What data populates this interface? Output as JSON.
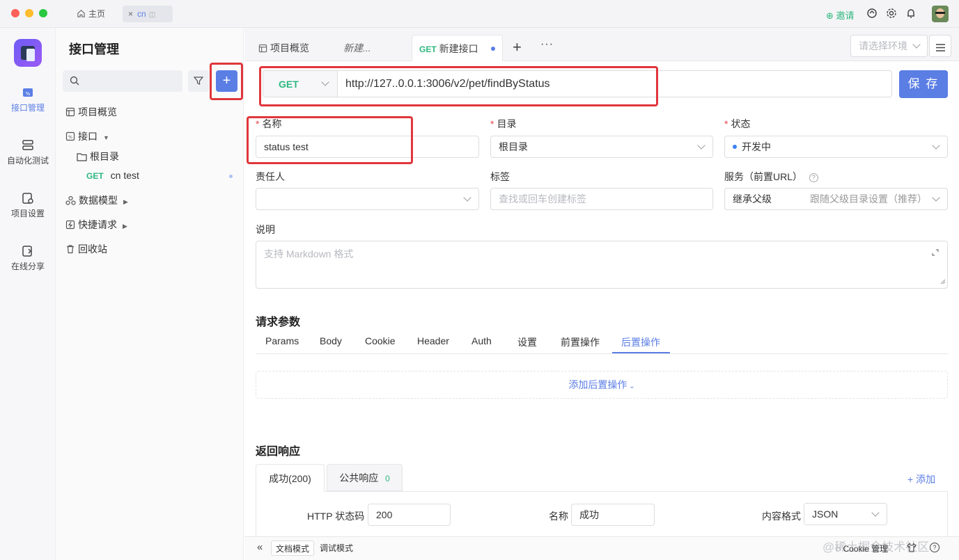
{
  "titlebar": {
    "home_tab": "主页",
    "project_tab": "cn",
    "invite": "邀请"
  },
  "leftnav": {
    "items": [
      {
        "label": "接口管理",
        "icon": "api-icon",
        "active": true
      },
      {
        "label": "自动化测试",
        "icon": "automation-icon",
        "active": false
      },
      {
        "label": "项目设置",
        "icon": "project-settings-icon",
        "active": false
      },
      {
        "label": "在线分享",
        "icon": "share-icon",
        "active": false
      }
    ]
  },
  "sidebar": {
    "title": "接口管理",
    "overview": "项目概览",
    "api": "接口",
    "root_folder": "根目录",
    "api_item": {
      "method": "GET",
      "name": "cn test"
    },
    "data_model": "数据模型",
    "quick_request": "快捷请求",
    "recycle_bin": "回收站"
  },
  "tabs": {
    "overview": "项目概览",
    "new_draft": "新建...",
    "current_method": "GET",
    "current_label": "新建接口",
    "env_placeholder": "请选择环境"
  },
  "request": {
    "method": "GET",
    "url": "http://127..0.0.1:3006/v2/pet/findByStatus",
    "save_label": "保 存"
  },
  "form": {
    "name_label": "名称",
    "name_value": "status test",
    "dir_label": "目录",
    "dir_value": "根目录",
    "status_label": "状态",
    "status_value": "开发中",
    "owner_label": "责任人",
    "tags_label": "标签",
    "tags_placeholder": "查找或回车创建标签",
    "service_label": "服务（前置URL）",
    "service_value": "继承父级",
    "service_hint": "跟随父级目录设置（推荐）",
    "desc_label": "说明",
    "desc_placeholder": "支持 Markdown 格式"
  },
  "params": {
    "title": "请求参数",
    "tabs": [
      "Params",
      "Body",
      "Cookie",
      "Header",
      "Auth",
      "设置",
      "前置操作",
      "后置操作"
    ],
    "active_tab": "后置操作",
    "add_post": "添加后置操作"
  },
  "response": {
    "title": "返回响应",
    "tab_success": "成功(200)",
    "tab_common": "公共响应",
    "tab_common_count": "0",
    "add": "+ 添加",
    "http_code_label": "HTTP 状态码",
    "http_code_value": "200",
    "name_label": "名称",
    "name_value": "成功",
    "content_label": "内容格式",
    "content_value": "JSON"
  },
  "bottom": {
    "doc_mode": "文档模式",
    "debug_mode": "调试模式",
    "cookie_manage": "Cookie 管理",
    "watermark": "@稀土掘金技术社区"
  },
  "colors": {
    "accent": "#5b7ee5",
    "get_green": "#2eb87f",
    "highlight_red": "#e0363b"
  }
}
